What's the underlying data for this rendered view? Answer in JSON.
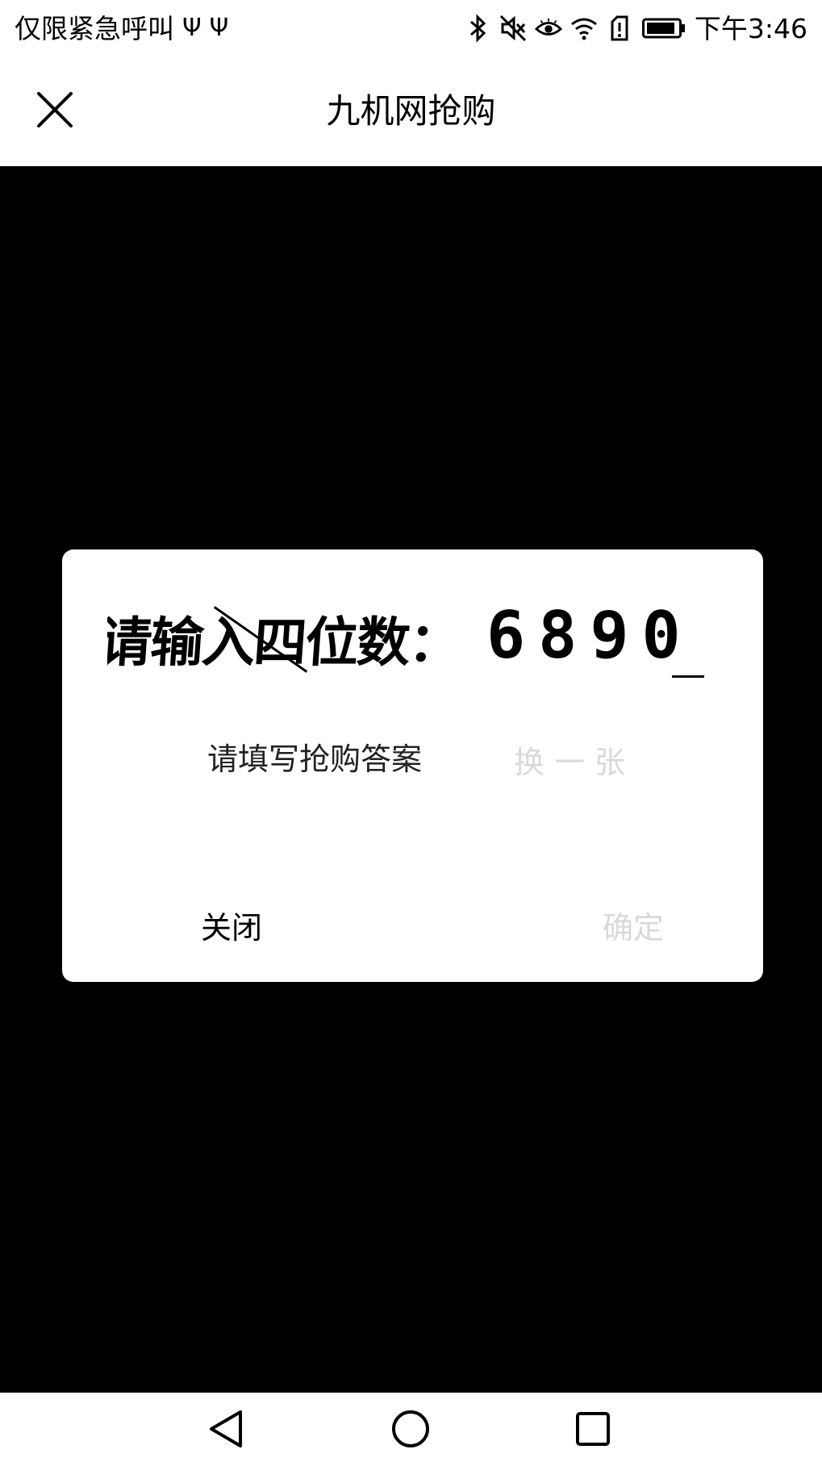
{
  "status_bar": {
    "carrier_text": "仅限紧急呼叫",
    "usb_glyph": "Ψ",
    "time": "下午3:46",
    "icons": [
      "usb-icon",
      "usb-icon",
      "bluetooth-icon",
      "mute-icon",
      "eye-comfort-icon",
      "wifi-icon",
      "sim-alert-icon",
      "battery-icon"
    ]
  },
  "header": {
    "title": "九机网抢购",
    "close_icon": "close-icon"
  },
  "dialog": {
    "captcha_prompt": "请输入四位数：",
    "captcha_digits": "6890",
    "answer_placeholder": "请填写抢购答案",
    "refresh_label": "换一张",
    "close_label": "关闭",
    "confirm_label": "确定"
  },
  "nav_bar": {
    "icons": [
      "back-icon",
      "home-icon",
      "recents-icon"
    ]
  },
  "colors": {
    "background": "#000000",
    "surface": "#ffffff",
    "disabled_text": "#d9d9d9"
  }
}
